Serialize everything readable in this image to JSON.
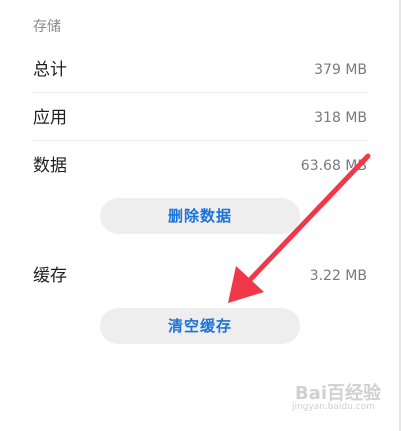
{
  "storage": {
    "section_title": "存储",
    "total": {
      "label": "总计",
      "value": "379 MB"
    },
    "apps": {
      "label": "应用",
      "value": "318 MB"
    },
    "data": {
      "label": "数据",
      "value": "63.68 MB"
    },
    "clear_data_button": "删除数据",
    "cache": {
      "label": "缓存",
      "value": "3.22 MB"
    },
    "clear_cache_button": "清空缓存"
  },
  "annotation": {
    "arrow_color": "#f0384a"
  },
  "watermark": {
    "logo": "Bai百经验",
    "url": "jingyan.baidu.com"
  }
}
